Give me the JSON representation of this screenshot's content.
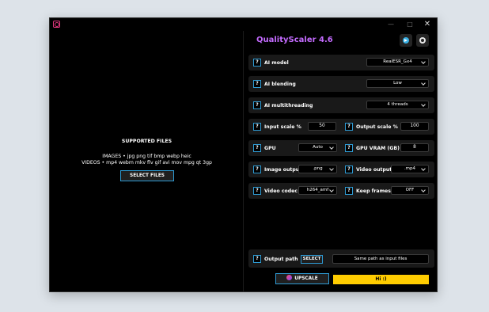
{
  "app": {
    "title": "QualityScaler 4.6",
    "accent_color": "#c46bff",
    "icons": [
      "telegram-icon",
      "github-icon"
    ]
  },
  "window_controls": {
    "minimize": "—",
    "maximize": "□",
    "close": "✕"
  },
  "file_panel": {
    "heading": "SUPPORTED FILES",
    "images_line": "IMAGES • jpg png tif bmp webp heic",
    "videos_line": "VIDEOS • mp4 webm mkv flv gif avi mov mpg qt 3gp",
    "select_button": "SELECT FILES"
  },
  "settings": {
    "help_glyph": "?",
    "ai_model": {
      "label": "AI model",
      "value": "RealESR_Gx4"
    },
    "ai_blending": {
      "label": "AI blending",
      "value": "Low"
    },
    "ai_multithreading": {
      "label": "AI multithreading",
      "value": "4 threads"
    },
    "input_scale": {
      "label": "Input scale %",
      "value": "50"
    },
    "output_scale": {
      "label": "Output scale %",
      "value": "100"
    },
    "gpu": {
      "label": "GPU",
      "value": "Auto"
    },
    "gpu_vram": {
      "label": "GPU VRAM (GB)",
      "value": "8"
    },
    "image_output": {
      "label": "Image output",
      "value": ".png"
    },
    "video_output": {
      "label": "Video output",
      "value": ".mp4"
    },
    "video_codec": {
      "label": "Video codec",
      "value": "h264_amf"
    },
    "keep_frames": {
      "label": "Keep frames",
      "value": "OFF"
    }
  },
  "output_path": {
    "label": "Output path",
    "select_button": "SELECT",
    "value": "Same path as input files"
  },
  "actions": {
    "upscale_button": "UPSCALE",
    "status_text": "Hi :)",
    "status_color": "#ffcc00"
  }
}
